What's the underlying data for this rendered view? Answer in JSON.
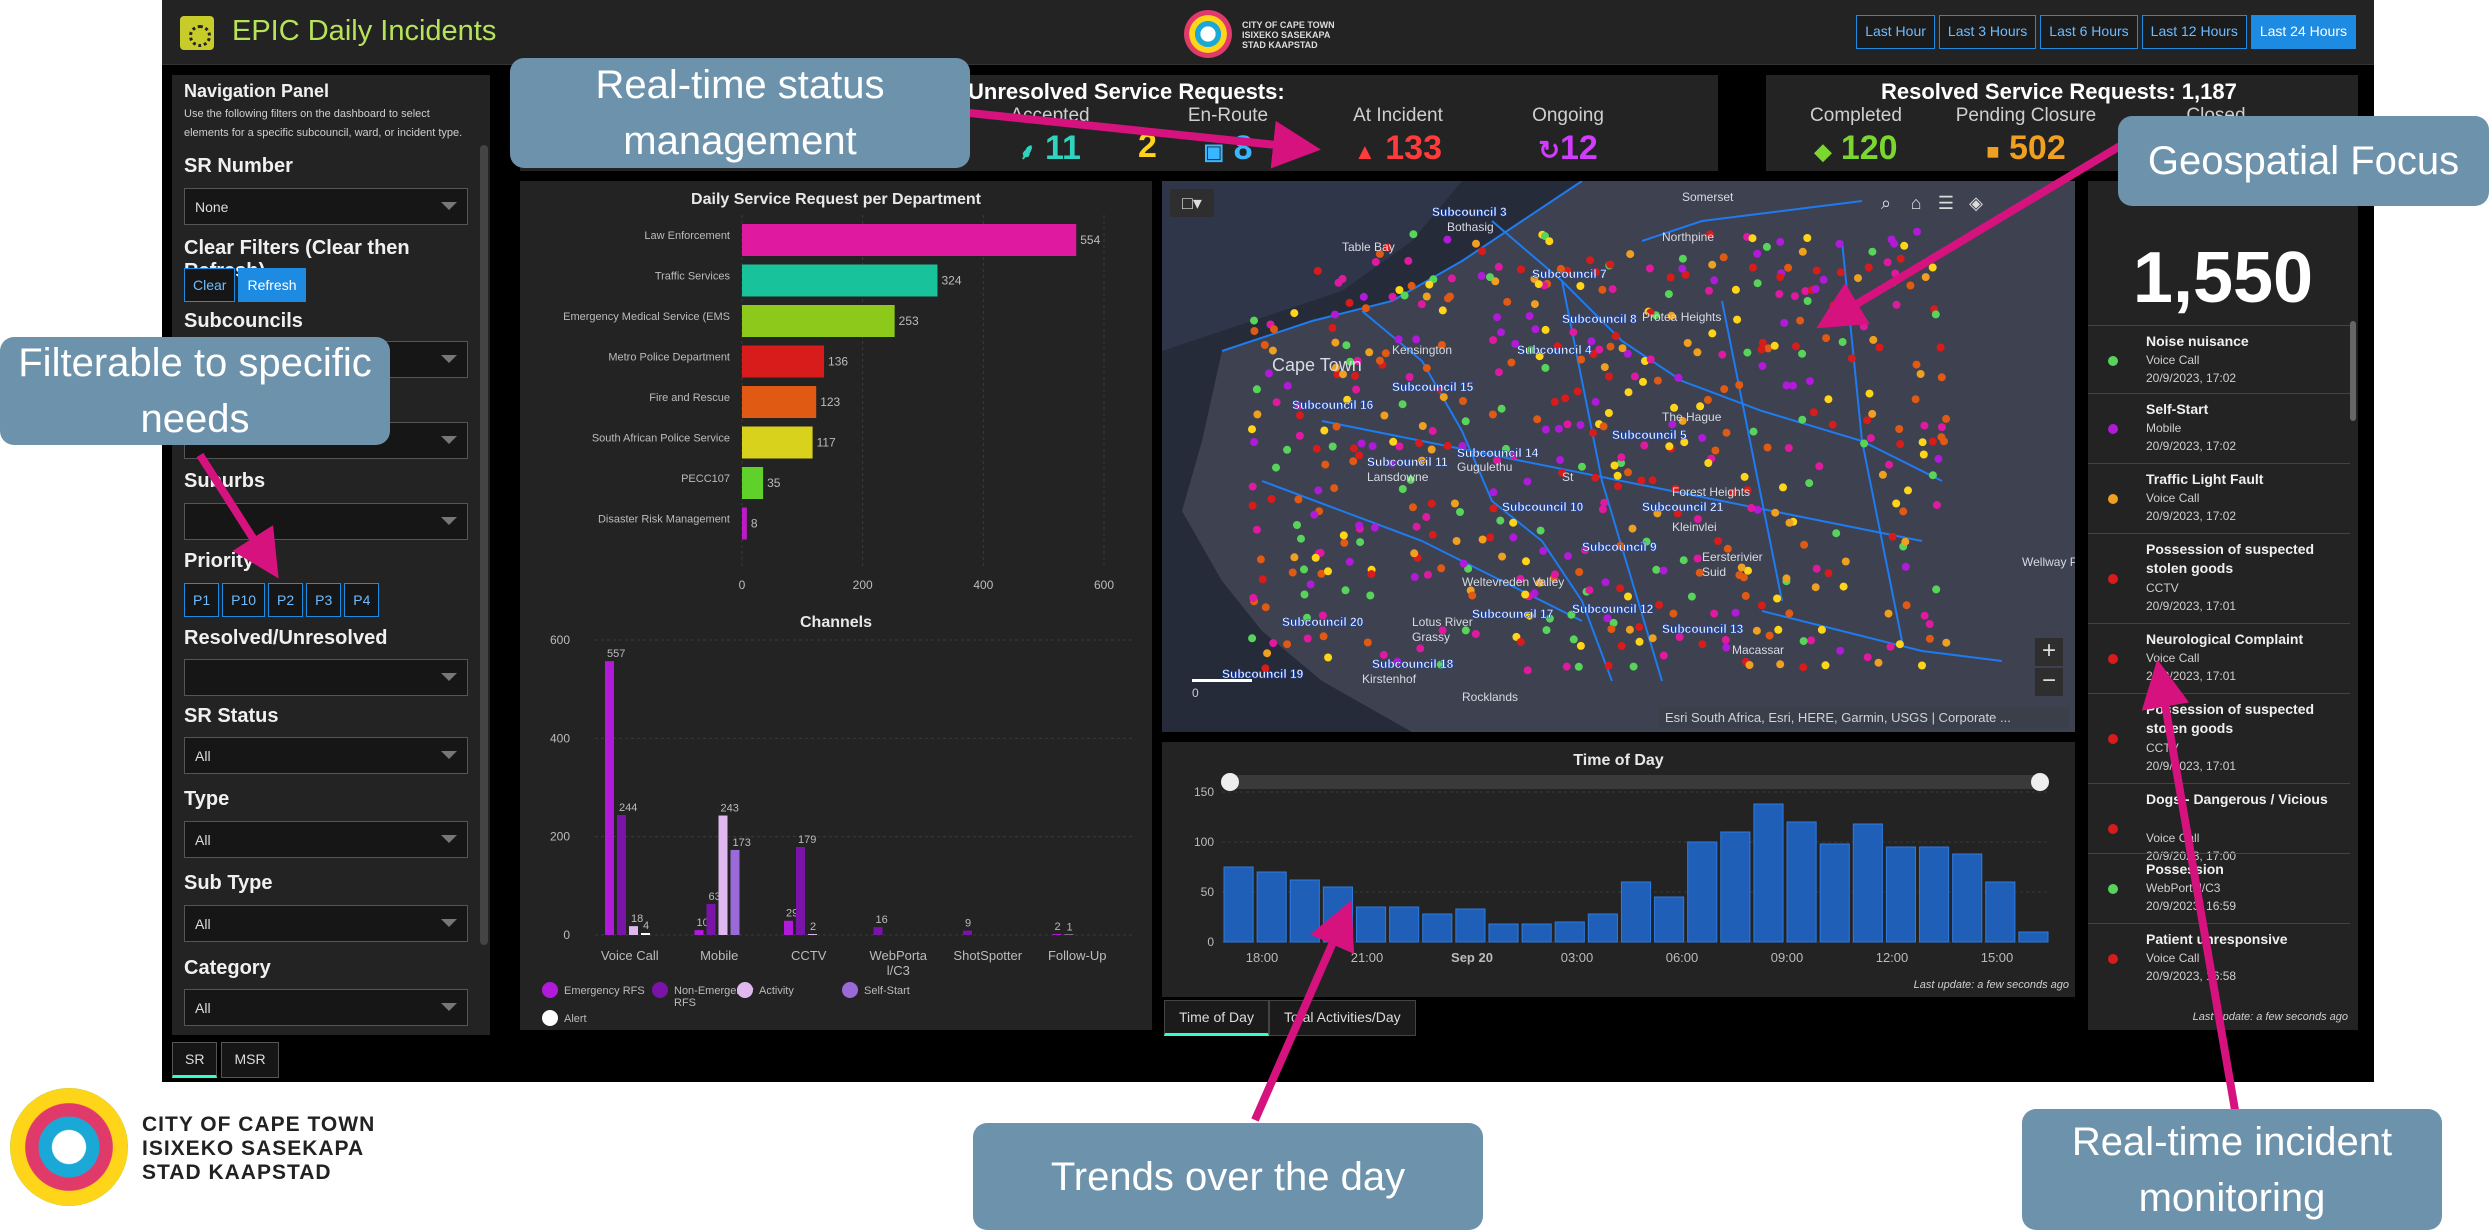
{
  "header": {
    "app_title": "EPIC Daily Incidents",
    "logo_text": "CITY OF CAPE TOWN\nISIXEKO SASEKAPA\nSTAD KAAPSTAD",
    "time_filters": [
      "Last Hour",
      "Last 3 Hours",
      "Last 6 Hours",
      "Last 12 Hours",
      "Last 24 Hours"
    ],
    "active_time_filter": "Last 24 Hours"
  },
  "nav": {
    "title": "Navigation Panel",
    "description": "Use the following filters on the dashboard to select elements for a specific subcouncil, ward, or incident type.",
    "sr_number_label": "SR Number",
    "sr_number_value": "None",
    "clear_filters_label": "Clear Filters (Clear then Refresh)",
    "clear_btn": "Clear",
    "refresh_btn": "Refresh",
    "subcouncils_label": "Subcouncils",
    "suburbs_label": "Suburbs",
    "priority_label": "Priority",
    "priorities": [
      "P1",
      "P10",
      "P2",
      "P3",
      "P4"
    ],
    "resolved_label": "Resolved/Unresolved",
    "sr_status_label": "SR Status",
    "sr_status_value": "All",
    "type_label": "Type",
    "type_value": "All",
    "subtype_label": "Sub Type",
    "subtype_value": "All",
    "category_label": "Category",
    "category_value": "All"
  },
  "bottom_tabs": [
    "SR",
    "MSR"
  ],
  "unresolved": {
    "title": "Unresolved Service Requests:",
    "items": [
      {
        "label": "Accepted",
        "value": "11",
        "icon": "broadcast-icon",
        "color": "#2fd3c0"
      },
      {
        "label": "En-Route",
        "value": "8",
        "icon": "car-icon",
        "color": "#38b6ff"
      },
      {
        "label": "At Incident",
        "value": "133",
        "icon": "siren-icon",
        "color": "#ff3b3b"
      },
      {
        "label": "Ongoing",
        "value": "12",
        "icon": "refresh-icon",
        "color": "#d23cff"
      }
    ],
    "partial_value": "2"
  },
  "resolved": {
    "title": "Resolved Service Requests: 1,187",
    "items": [
      {
        "label": "Completed",
        "value": "120",
        "icon": "shield-check-icon",
        "color": "#7cd630"
      },
      {
        "label": "Pending Closure",
        "value": "502",
        "icon": "pending-icon",
        "color": "#f0a020"
      }
    ],
    "partial_label": "Closed"
  },
  "dept_chart": {
    "chart_data": {
      "type": "bar",
      "title": "Daily Service Request per Department",
      "categories": [
        "Law Enforcement",
        "Traffic Services",
        "Emergency Medical Service (EMS",
        "Metro Police Department",
        "Fire and Rescue",
        "South African Police Service",
        "PECC107",
        "Disaster Risk Management"
      ],
      "values": [
        554,
        324,
        253,
        136,
        123,
        117,
        35,
        8
      ],
      "colors": [
        "#e01aa0",
        "#18c29a",
        "#8cc91a",
        "#d81c1c",
        "#e05a14",
        "#d8d21c",
        "#5fd12a",
        "#c01ac8"
      ],
      "xlim": [
        0,
        600
      ],
      "xticks": [
        "0",
        "200",
        "400",
        "600"
      ],
      "orientation": "horizontal"
    }
  },
  "channels_chart": {
    "chart_data": {
      "type": "bar",
      "title": "Channels",
      "categories": [
        "Voice Call",
        "Mobile",
        "CCTV",
        "WebPorta l/C3",
        "ShotSpotter",
        "Follow-Up"
      ],
      "series": [
        {
          "name": "Emergency RFS",
          "color": "#b01ad8",
          "values": [
            557,
            10,
            29,
            0,
            0,
            2
          ]
        },
        {
          "name": "Non-Emergency RFS",
          "color": "#7a14a8",
          "values": [
            244,
            63,
            179,
            16,
            9,
            0
          ]
        },
        {
          "name": "Activity",
          "color": "#e0b8f0",
          "values": [
            18,
            243,
            2,
            0,
            0,
            1
          ]
        },
        {
          "name": "Self-Start",
          "color": "#9a6ad8",
          "values": [
            0,
            173,
            0,
            0,
            0,
            0
          ]
        },
        {
          "name": "Alert",
          "color": "#ffffff",
          "values": [
            4,
            0,
            0,
            0,
            0,
            0
          ]
        }
      ],
      "labels": [
        [
          "557",
          "244",
          "18",
          "4"
        ],
        [
          "10",
          "63",
          "243",
          "173"
        ],
        [
          "29",
          "179",
          "2"
        ],
        [
          "16"
        ],
        [
          "9"
        ],
        [
          "2",
          "1"
        ]
      ],
      "ylim": [
        0,
        600
      ],
      "yticks": [
        "0",
        "200",
        "400",
        "600"
      ]
    }
  },
  "map": {
    "labels": [
      "Table Bay",
      "Cape Town",
      "Subcouncil 3",
      "Bothasig",
      "Northpine",
      "Subcouncil 7",
      "Kensington",
      "Subcouncil 4",
      "Subcouncil 8",
      "Protea Heights",
      "Subcouncil 16",
      "Subcouncil 15",
      "The Hague",
      "Subcouncil 5",
      "Subcouncil 11",
      "Lansdowne",
      "Subcouncil 14",
      "Gugulethu",
      "Subcouncil 10",
      "Subcouncil 21",
      "Kleinvlei",
      "Forest Heights",
      "Subcouncil 9",
      "Eersterivier",
      "Suid",
      "Weltevreden Valley",
      "Subcouncil 20",
      "Lotus River",
      "Grassy",
      "Subcouncil 17",
      "Subcouncil 12",
      "Subcouncil 18",
      "Subcouncil 19",
      "Subcouncil 13",
      "Macassar",
      "Kirstenhof",
      "Rocklands",
      "Somerset",
      "Wellway Park East",
      "St"
    ],
    "attribution": "Esri South Africa, Esri, HERE, Garmin, USGS | Corporate ...",
    "scale": "0",
    "tools": [
      "search-icon",
      "home-icon",
      "list-icon",
      "layers-icon"
    ]
  },
  "time_of_day": {
    "tab_active": "Time of Day",
    "tab_other": "Total Activities/Day",
    "update_text": "Last update: a few seconds ago",
    "chart_data": {
      "type": "bar",
      "title": "Time of Day",
      "xticks": [
        "18:00",
        "21:00",
        "Sep 20",
        "03:00",
        "06:00",
        "09:00",
        "12:00",
        "15:00"
      ],
      "values": [
        75,
        70,
        62,
        55,
        35,
        35,
        28,
        33,
        18,
        18,
        20,
        28,
        60,
        45,
        100,
        110,
        138,
        120,
        98,
        118,
        95,
        95,
        88,
        60,
        10
      ],
      "yticks": [
        "0",
        "50",
        "100",
        "150"
      ],
      "ylim": [
        0,
        150
      ]
    }
  },
  "feed": {
    "count": "1,550",
    "update_text": "Last update: a few seconds ago",
    "items": [
      {
        "title": "Noise nuisance",
        "channel": "Voice Call",
        "time": "20/9/2023, 17:02",
        "color": "#58d45a"
      },
      {
        "title": "Self-Start",
        "channel": "Mobile",
        "time": "20/9/2023, 17:02",
        "color": "#b01ad8"
      },
      {
        "title": "Traffic Light Fault",
        "channel": "Voice Call",
        "time": "20/9/2023, 17:02",
        "color": "#f0a020"
      },
      {
        "title": "Possession of suspected stolen goods",
        "channel": "CCTV",
        "time": "20/9/2023, 17:01",
        "color": "#d81c1c"
      },
      {
        "title": "Neurological Complaint",
        "channel": "Voice Call",
        "time": "20/9/2023, 17:01",
        "color": "#d81c1c"
      },
      {
        "title": "Possession of suspected stolen goods",
        "channel": "CCTV",
        "time": "20/9/2023, 17:01",
        "color": "#d81c1c"
      },
      {
        "title": "Dogs - Dangerous / Vicious",
        "channel": "Voice Call",
        "time": "20/9/2023, 17:00",
        "color": "#d81c1c"
      },
      {
        "title": "Possession",
        "channel": "WebPortal/C3",
        "time": "20/9/2023, 16:59",
        "color": "#58d45a"
      },
      {
        "title": "Patient unresponsive",
        "channel": "Voice Call",
        "time": "20/9/2023, 16:58",
        "color": "#d81c1c"
      }
    ]
  },
  "footer": {
    "logo_text_1": "CITY OF CAPE TOWN",
    "logo_text_2": "ISIXEKO SASEKAPA",
    "logo_text_3": "STAD KAAPSTAD"
  },
  "callouts": {
    "status": "Real-time status management",
    "filter": "Filterable to specific needs",
    "geo": "Geospatial Focus",
    "trends": "Trends over the day",
    "monitor": "Real-time incident monitoring"
  },
  "colors": {
    "arrow": "#d6127f",
    "callout": "#6d92ab"
  }
}
